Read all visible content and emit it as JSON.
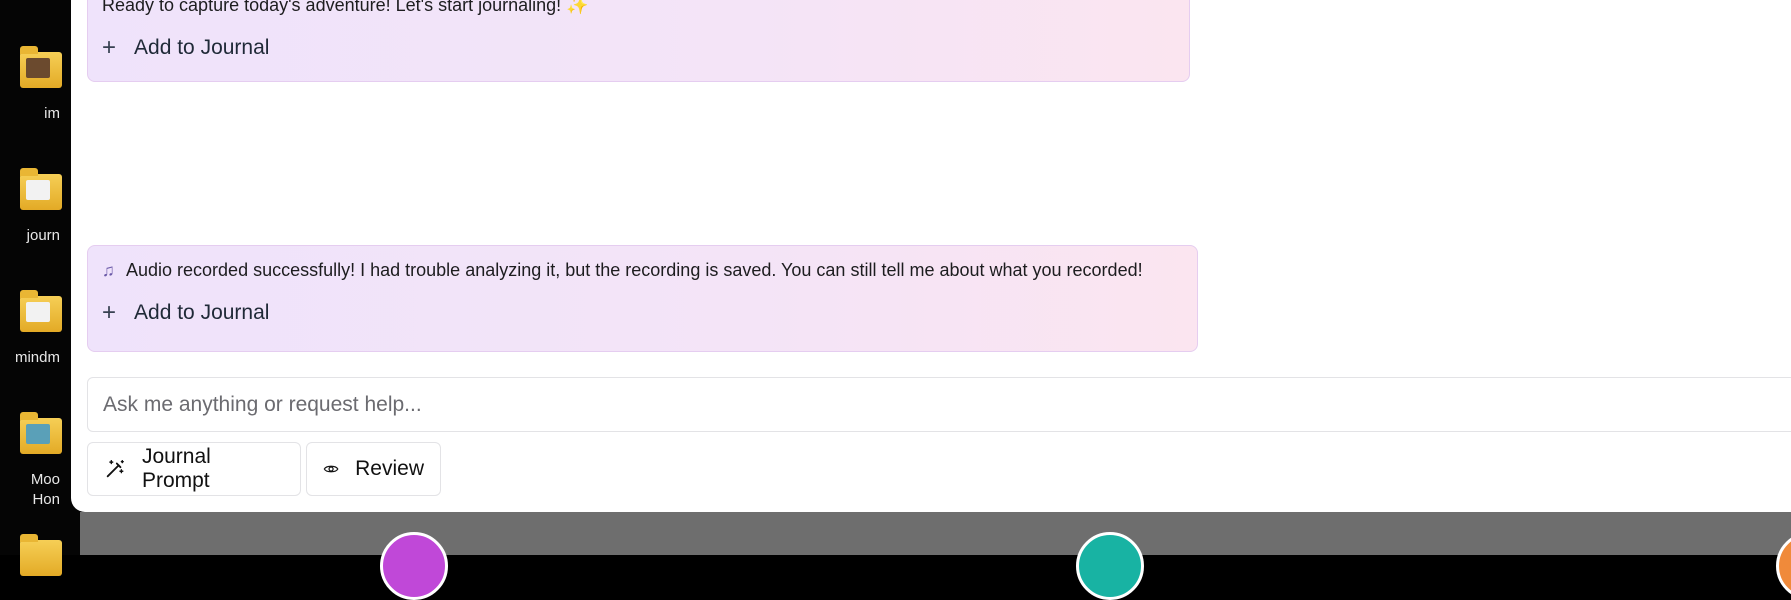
{
  "desktop": {
    "icons": [
      {
        "label": "im",
        "icon": "image-folder-icon"
      },
      {
        "label": "journ",
        "icon": "folder-icon"
      },
      {
        "label": "mindm",
        "icon": "folder-icon"
      },
      {
        "label": "Moo\nHon",
        "icon": "image-folder-icon"
      }
    ]
  },
  "chat": {
    "messages": [
      {
        "text": "Ready to capture today's adventure! Let's start journaling! ✨",
        "action_label": "Add to Journal"
      },
      {
        "icon": "music-note-icon",
        "text": "Audio recorded successfully! I had trouble analyzing it, but the recording is saved. You can still tell me about what you recorded!",
        "action_label": "Add to Journal"
      }
    ],
    "input": {
      "placeholder": "Ask me anything or request help...",
      "value": ""
    },
    "buttons": [
      {
        "label": "Journal Prompt",
        "icon": "magic-wand-icon"
      },
      {
        "label": "Review",
        "icon": "eye-icon"
      }
    ]
  },
  "colors": {
    "card_start": "#efe3fb",
    "card_end": "#fbe5f0",
    "card_border": "#e5cdf0",
    "bottom_bar": "#6e6e6e",
    "avatar_1": "#c048d8",
    "avatar_2": "#18b3a3"
  }
}
